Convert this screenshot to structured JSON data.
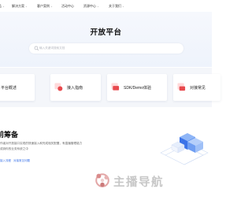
{
  "nav": {
    "items": [
      {
        "label": "品"
      },
      {
        "label": "解决方案"
      },
      {
        "label": "客户案例"
      },
      {
        "label": "活动中心"
      },
      {
        "label": "资源中心"
      },
      {
        "label": "关于我们"
      }
    ]
  },
  "hero": {
    "title": "开放平台",
    "search_placeholder": "输入关键词搜索文档"
  },
  "cards": [
    {
      "label": "平台概述"
    },
    {
      "label": "接入指南"
    },
    {
      "label": "SDK/Demo体验"
    },
    {
      "label": "对接常见"
    }
  ],
  "prep": {
    "title": "前筹备",
    "desc_line1": "作者对开放接口实现的快速接入和完成相关配置，有直播管理能力",
    "desc_line2": "成到你的业务系统之中",
    "link1": "接入流程",
    "link2": "对接常见问题"
  },
  "watermark": {
    "text": "主播导航"
  },
  "colors": {
    "accent": "#3b73e8",
    "card_icon_red": "#e8494d",
    "hero_bg": "#eef3fc"
  }
}
